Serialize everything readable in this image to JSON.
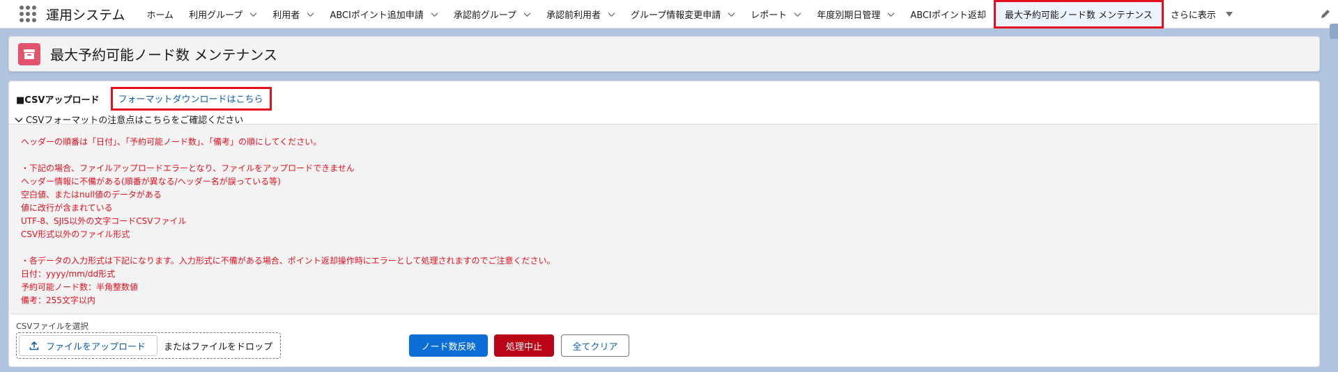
{
  "app": {
    "name": "運用システム"
  },
  "nav": {
    "items": [
      {
        "label": "ホーム",
        "dropdown": false
      },
      {
        "label": "利用グループ",
        "dropdown": true
      },
      {
        "label": "利用者",
        "dropdown": true
      },
      {
        "label": "ABCIポイント追加申請",
        "dropdown": true
      },
      {
        "label": "承認前グループ",
        "dropdown": true
      },
      {
        "label": "承認前利用者",
        "dropdown": true
      },
      {
        "label": "グループ情報変更申請",
        "dropdown": true
      },
      {
        "label": "レポート",
        "dropdown": true
      },
      {
        "label": "年度別期日管理",
        "dropdown": true
      },
      {
        "label": "ABCIポイント返却",
        "dropdown": false
      },
      {
        "label": "最大予約可能ノード数 メンテナンス",
        "dropdown": false,
        "active": true
      }
    ],
    "more_label": "さらに表示"
  },
  "header": {
    "title": "最大予約可能ノード数 メンテナンス",
    "icon": "archive-icon"
  },
  "upload_section": {
    "label": "■CSVアップロード",
    "format_link": "フォーマットダウンロードはこちら",
    "notes_toggle": "CSVフォーマットの注意点はこちらをご確認ください",
    "notes": [
      "ヘッダーの順番は「日付」、「予約可能ノード数」、「備考」の順にしてください。",
      "",
      "・下記の場合、ファイルアップロードエラーとなり、ファイルをアップロードできません",
      "ヘッダー情報に不備がある(順番が異なる/ヘッダー名が誤っている等)",
      "空白値、またはnull値のデータがある",
      "値に改行が含まれている",
      "UTF-8、SJIS以外の文字コードCSVファイル",
      "CSV形式以外のファイル形式",
      "",
      "・各データの入力形式は下記になります。入力形式に不備がある場合、ポイント返却操作時にエラーとして処理されますのでご注意ください。",
      "日付：yyyy/mm/dd形式",
      "予約可能ノード数：半角整数値",
      "備考：255文字以内"
    ],
    "file_select_label": "CSVファイルを選択",
    "upload_button": "ファイルをアップロード",
    "drop_text": "またはファイルをドロップ"
  },
  "actions": {
    "apply": "ノード数反映",
    "abort": "処理中止",
    "clear": "全てクリア"
  },
  "colors": {
    "primary": "#0b6fd7",
    "danger": "#ba0517",
    "notes_text": "#e5101e",
    "header_icon": "#e3536d",
    "highlight_border": "#e5101e"
  }
}
